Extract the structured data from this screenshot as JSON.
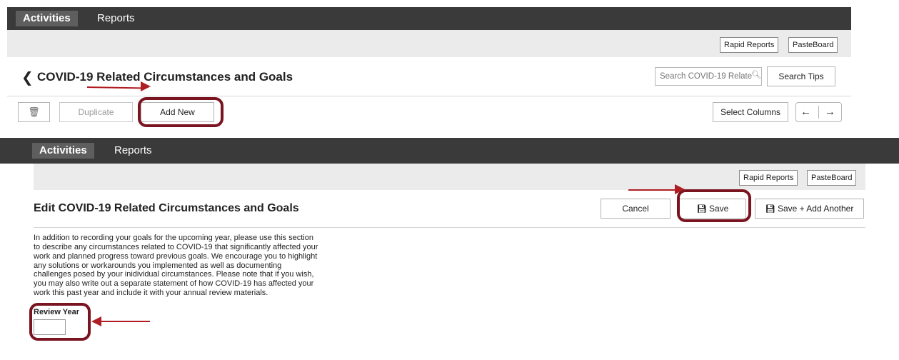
{
  "panel_top": {
    "nav": {
      "activities": "Activities",
      "reports": "Reports"
    },
    "toolbar": {
      "rapid_reports": "Rapid Reports",
      "pasteboard": "PasteBoard"
    },
    "title": "COVID-19 Related Circumstances and Goals",
    "search": {
      "placeholder": "Search COVID-19 Relate"
    },
    "search_tips": "Search Tips",
    "actions": {
      "duplicate": "Duplicate",
      "add_new": "Add New",
      "select_columns": "Select Columns"
    }
  },
  "panel_bottom": {
    "nav": {
      "activities": "Activities",
      "reports": "Reports"
    },
    "toolbar": {
      "rapid_reports": "Rapid Reports",
      "pasteboard": "PasteBoard"
    },
    "title": "Edit COVID-19 Related Circumstances and Goals",
    "actions": {
      "cancel": "Cancel",
      "save": "Save",
      "save_add_another": "Save + Add Another"
    },
    "description": "In addition to recording your goals for the upcoming year, please use this section to describe any circumstances related to COVID-19 that significantly affected your work and planned progress toward previous goals. We encourage you to highlight any solutions or workarounds you implemented as well as documenting challenges posed by your inidividual circumstances. Please note that if you wish, you may also write out a separate statement of how COVID-19 has affected your work this past year and include it with your annual review materials.",
    "review_year": {
      "label": "Review Year",
      "value": ""
    }
  },
  "colors": {
    "nav_bg": "#3a3a3a",
    "toolbar_bg": "#ebebeb",
    "highlight": "#7a1420",
    "arrow": "#b01e24"
  }
}
